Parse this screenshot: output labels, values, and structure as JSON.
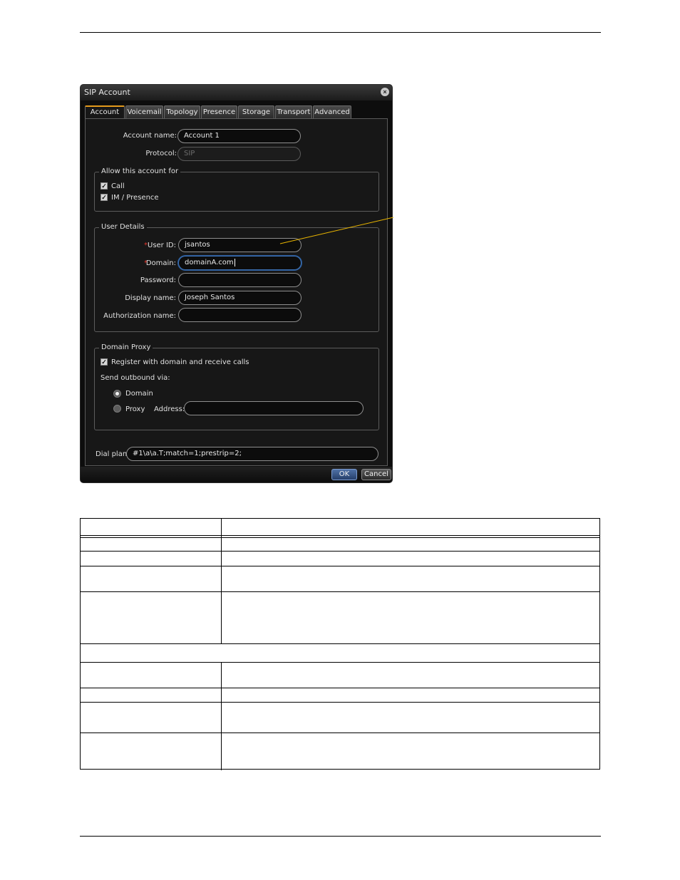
{
  "dialog": {
    "title": "SIP Account",
    "tabs": [
      {
        "label": "Account",
        "active": true
      },
      {
        "label": "Voicemail"
      },
      {
        "label": "Topology"
      },
      {
        "label": "Presence"
      },
      {
        "label": "Storage"
      },
      {
        "label": "Transport"
      },
      {
        "label": "Advanced"
      }
    ],
    "account_name": {
      "label": "Account name:",
      "value": "Account 1"
    },
    "protocol": {
      "label": "Protocol:",
      "value": "SIP"
    },
    "allow": {
      "legend": "Allow this account for",
      "call": "Call",
      "im_presence": "IM / Presence"
    },
    "user_details": {
      "legend": "User Details",
      "required_mark": "*",
      "user_id": {
        "label": "User ID:",
        "value": "jsantos"
      },
      "domain": {
        "label": "Domain:",
        "value": "domainA.com"
      },
      "password": {
        "label": "Password:",
        "value": ""
      },
      "display_name": {
        "label": "Display name:",
        "value": "Joseph Santos"
      },
      "auth_name": {
        "label": "Authorization name:",
        "value": ""
      }
    },
    "domain_proxy": {
      "legend": "Domain Proxy",
      "register_label": "Register with domain and receive calls",
      "send_outbound": "Send outbound via:",
      "domain_option": "Domain",
      "proxy_option": "Proxy",
      "address_label": "Address:",
      "address_value": ""
    },
    "dial_plan": {
      "label": "Dial plan:",
      "value": "#1\\a\\a.T;match=1;prestrip=2;"
    },
    "buttons": {
      "ok": "OK",
      "cancel": "Cancel"
    },
    "close_glyph": "×",
    "check_glyph": "✓"
  },
  "colors": {
    "callout_line": "#e8b400",
    "active_tab_accent": "#e39a1c",
    "required": "#e0352b"
  }
}
